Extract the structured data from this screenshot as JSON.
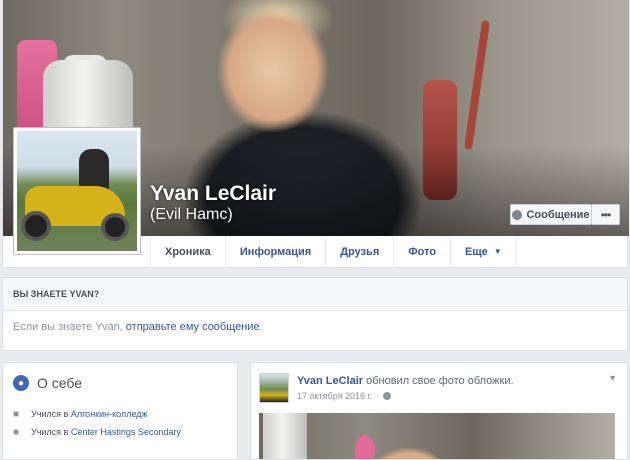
{
  "profile": {
    "name": "Yvan LeClair",
    "alternate_name": "(Evil Hamc)",
    "message_button": "Сообщение",
    "more_button": "•••"
  },
  "tabs": [
    {
      "label": "Хроника"
    },
    {
      "label": "Информация"
    },
    {
      "label": "Друзья"
    },
    {
      "label": "Фото"
    },
    {
      "label": "Еще"
    }
  ],
  "know_card": {
    "heading": "ВЫ ЗНАЕТЕ YVAN?",
    "text_prefix": "Если вы знаете Yvan, ",
    "link_text": "отправьте ему сообщение",
    "text_suffix": "."
  },
  "about": {
    "title": "О себе",
    "items": [
      {
        "prefix": "Учился в ",
        "link": "Алгонкин-колледж"
      },
      {
        "prefix": "Учился в ",
        "link": "Center Hastings Secondary"
      }
    ]
  },
  "post": {
    "author": "Yvan LeClair",
    "action": " обновил свое фото обложки.",
    "date": "17 октября 2016 г.",
    "separator": "·",
    "privacy_icon": "globe-icon"
  },
  "colors": {
    "link": "#365899",
    "brand": "#4267b2",
    "background": "#e9ebee"
  }
}
